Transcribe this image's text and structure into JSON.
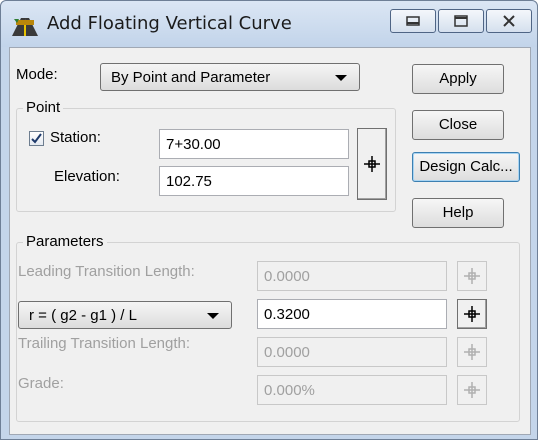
{
  "window": {
    "title": "Add Floating Vertical Curve",
    "icon": "road-curve-icon",
    "controls": [
      "minimize-icon",
      "restore-icon",
      "close-icon"
    ]
  },
  "mode": {
    "label": "Mode:",
    "selected": "By Point and Parameter"
  },
  "point": {
    "group_label": "Point",
    "station": {
      "label": "Station:",
      "value": "7+30.00",
      "checked": true
    },
    "elevation": {
      "label": "Elevation:",
      "value": "102.75"
    }
  },
  "buttons": {
    "apply": "Apply",
    "close": "Close",
    "design_calc": "Design Calc...",
    "help": "Help"
  },
  "parameters": {
    "group_label": "Parameters",
    "leading": {
      "label": "Leading Transition Length:",
      "value": "0.0000",
      "enabled": false
    },
    "formula": {
      "selected": "r = ( g2 - g1 ) / L",
      "value": "0.3200",
      "enabled": true
    },
    "trailing": {
      "label": "Trailing Transition Length:",
      "value": "0.0000",
      "enabled": false
    },
    "grade": {
      "label": "Grade:",
      "value": "0.000%",
      "enabled": false
    }
  },
  "colors": {
    "titlebar": "#c4d5ea",
    "client": "#f0f0f0",
    "disabled_text": "#a0a0a0"
  }
}
